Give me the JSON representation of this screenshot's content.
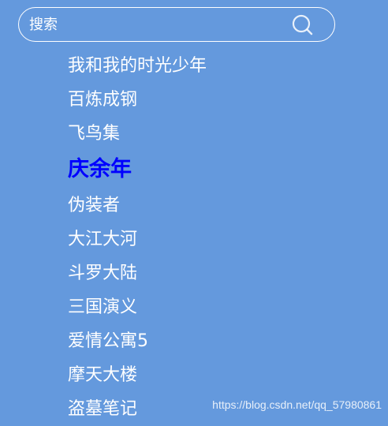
{
  "search": {
    "placeholder": "搜索",
    "value": "",
    "icon": "search-icon"
  },
  "colors": {
    "background": "#6499DD",
    "text": "#FFFFFF",
    "active_text": "#0000FF"
  },
  "results": {
    "items": [
      {
        "label": "我和我的时光少年",
        "active": false
      },
      {
        "label": "百炼成钢",
        "active": false
      },
      {
        "label": "飞鸟集",
        "active": false
      },
      {
        "label": "庆余年",
        "active": true
      },
      {
        "label": "伪装者",
        "active": false
      },
      {
        "label": "大江大河",
        "active": false
      },
      {
        "label": "斗罗大陆",
        "active": false
      },
      {
        "label": "三国演义",
        "active": false
      },
      {
        "label": "爱情公寓5",
        "active": false
      },
      {
        "label": "摩天大楼",
        "active": false
      },
      {
        "label": "盗墓笔记",
        "active": false
      }
    ]
  },
  "watermark": {
    "text": "https://blog.csdn.net/qq_57980861"
  }
}
